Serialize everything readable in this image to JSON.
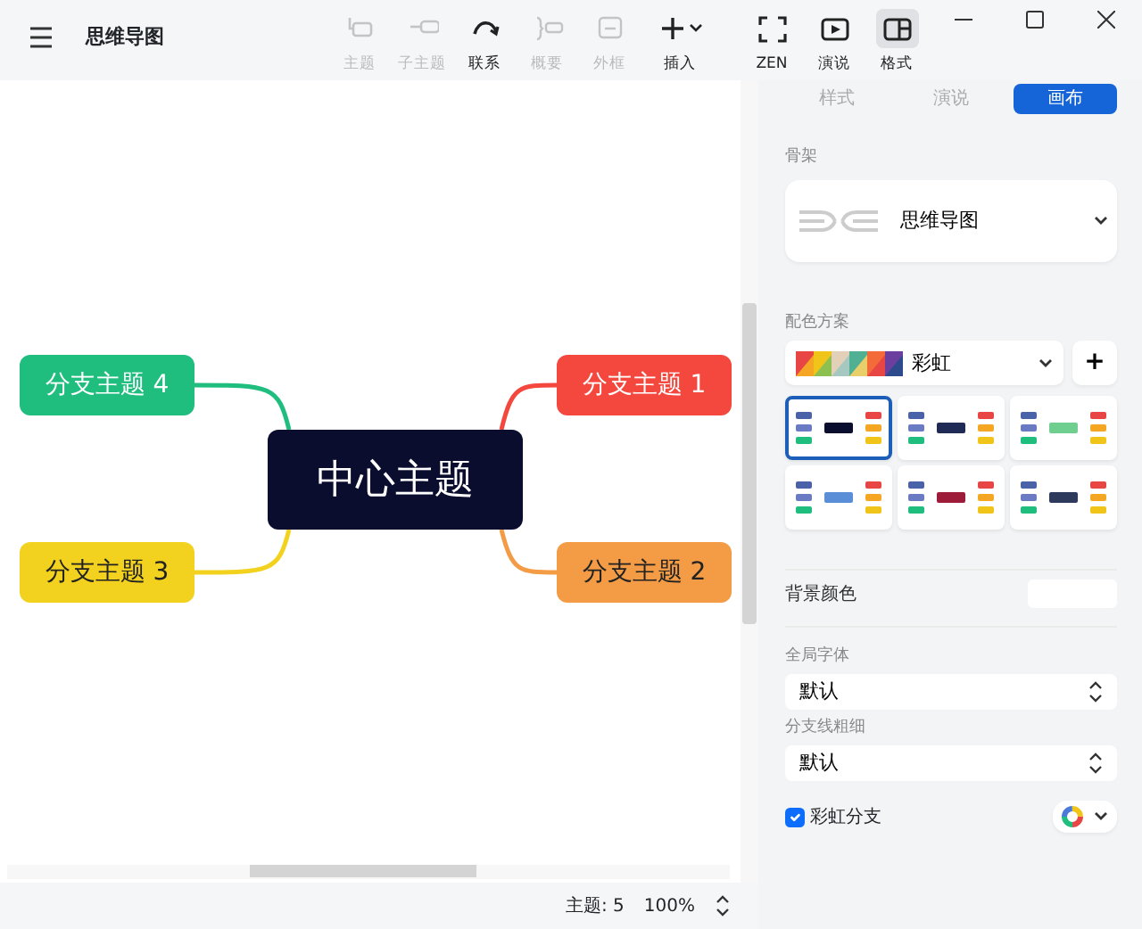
{
  "window": {
    "title": "思维导图"
  },
  "toolbar": [
    {
      "kind": "topic",
      "label": "主题",
      "disabled": true,
      "dropdown": false,
      "selected": false
    },
    {
      "kind": "subtopic",
      "label": "子主题",
      "disabled": true,
      "dropdown": false,
      "selected": false
    },
    {
      "kind": "relation",
      "label": "联系",
      "disabled": false,
      "dropdown": false,
      "selected": false
    },
    {
      "kind": "summary",
      "label": "概要",
      "disabled": true,
      "dropdown": false,
      "selected": false
    },
    {
      "kind": "boundary",
      "label": "外框",
      "disabled": true,
      "dropdown": false,
      "selected": false
    },
    {
      "kind": "insert",
      "label": "插入",
      "disabled": false,
      "dropdown": true,
      "selected": false
    },
    {
      "kind": "zen",
      "label": "ZEN",
      "disabled": false,
      "dropdown": false,
      "selected": false
    },
    {
      "kind": "present",
      "label": "演说",
      "disabled": false,
      "dropdown": false,
      "selected": false
    },
    {
      "kind": "format",
      "label": "格式",
      "disabled": false,
      "dropdown": false,
      "selected": true
    }
  ],
  "map": {
    "central": "中心主题",
    "branches": [
      {
        "label": "分支主题 4",
        "color": "#1fbd7e"
      },
      {
        "label": "分支主题 1",
        "color": "#f4473e"
      },
      {
        "label": "分支主题 3",
        "color": "#f2d21f"
      },
      {
        "label": "分支主题 2",
        "color": "#f39c45"
      }
    ]
  },
  "status_bar": {
    "topics": "主题: 5",
    "zoom": "100%"
  },
  "panel": {
    "tabs": [
      {
        "label": "样式",
        "selected": false,
        "disabled": true
      },
      {
        "label": "演说",
        "selected": false,
        "disabled": true
      },
      {
        "label": "画布",
        "selected": true,
        "disabled": false
      }
    ],
    "structure": {
      "label": "骨架",
      "value": "思维导图"
    },
    "color_scheme": {
      "label": "配色方案",
      "value": "彩虹",
      "add": "+",
      "themes": [
        {
          "selected": true
        },
        {
          "selected": false
        },
        {
          "selected": false
        },
        {
          "selected": false
        },
        {
          "selected": false
        },
        {
          "selected": false
        }
      ]
    },
    "background": {
      "label": "背景颜色"
    },
    "font": {
      "label": "全局字体",
      "value": "默认"
    },
    "branch_width": {
      "label": "分支线粗细",
      "value": "默认"
    },
    "rainbow_branch": {
      "label": "彩虹分支",
      "checked": true
    }
  }
}
